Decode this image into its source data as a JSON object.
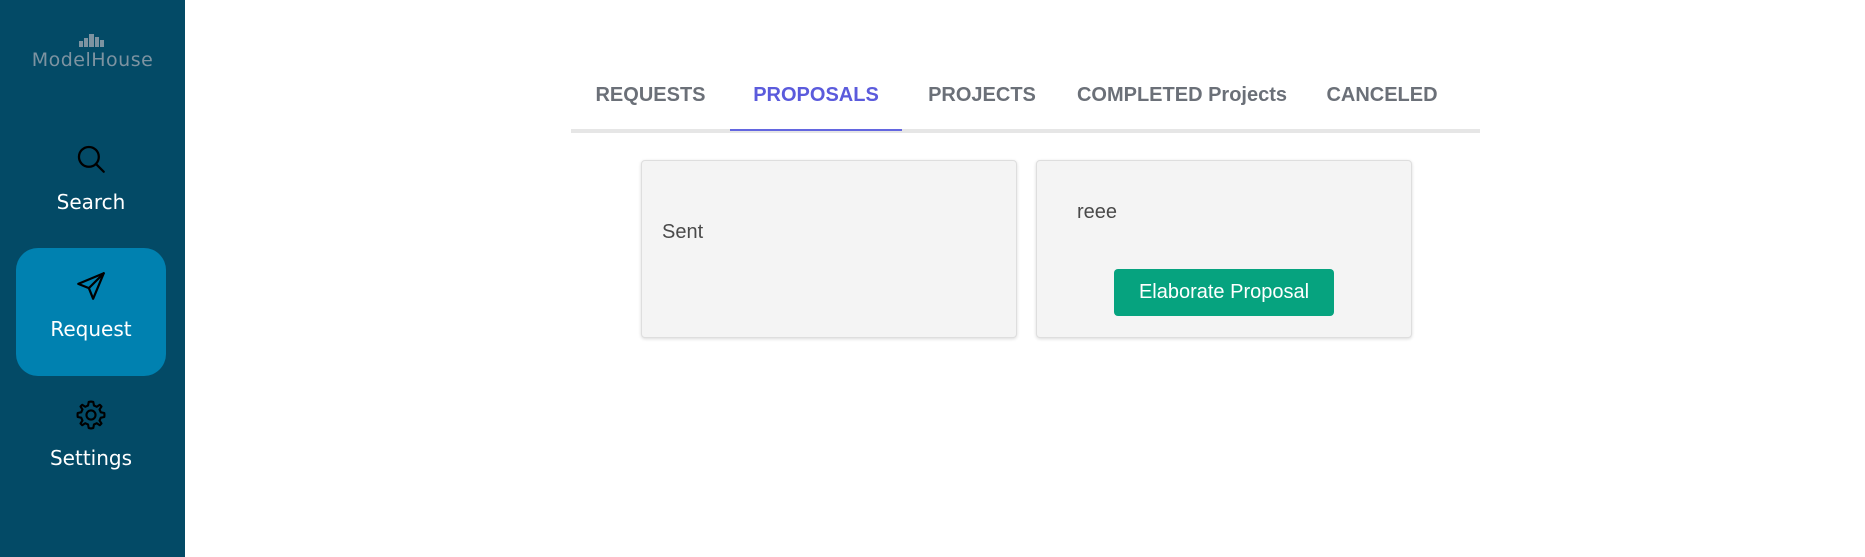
{
  "app": {
    "logo_text": "ModelHouse"
  },
  "sidebar": {
    "items": [
      {
        "label": "Search",
        "icon": "search-icon",
        "active": false
      },
      {
        "label": "Request",
        "icon": "send-icon",
        "active": true
      },
      {
        "label": "Settings",
        "icon": "gear-icon",
        "active": false
      }
    ]
  },
  "tabs": [
    {
      "label": "REQUESTS",
      "active": false
    },
    {
      "label": "PROPOSALS",
      "active": true
    },
    {
      "label": "PROJECTS",
      "active": false
    },
    {
      "label": "COMPLETED Projects",
      "active": false
    },
    {
      "label": "CANCELED",
      "active": false
    }
  ],
  "cards": [
    {
      "text": "Sent"
    },
    {
      "text": "reee",
      "button_label": "Elaborate Proposal"
    }
  ],
  "colors": {
    "sidebar_bg": "#034a66",
    "sidebar_active_bg": "#0081b0",
    "tab_active": "#5b5bdc",
    "button_bg": "#06a37f"
  }
}
